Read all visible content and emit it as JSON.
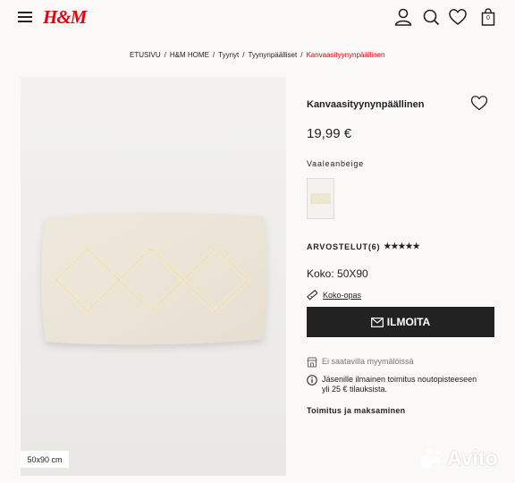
{
  "header": {
    "logo": "H&M",
    "bag_count": "0"
  },
  "breadcrumb": {
    "items": [
      "ETUSIVU",
      "H&M HOME",
      "Tyynyt",
      "Tyynynpäälliset"
    ],
    "current": "Kanvaasityynynpäällinen",
    "separator": "/"
  },
  "product": {
    "title": "Kanvaasityynynpäällinen",
    "price": "19,99 €",
    "color_name": "Vaaleanbeige",
    "size_tag": "50x90 cm",
    "reviews_label": "ARVOSTELUT(6)",
    "rating": 5,
    "size_label": "Koko: 50X90",
    "size_guide_label": "Koko-opas",
    "notify_button": "ILMOITA",
    "store_availability": "Ei saatavilla myymälöissä",
    "members_info": [
      "Jäsenille ilmainen toimitus noutopisteeseen",
      "yli 25 € tilauksista."
    ],
    "delivery_link": "Toimitus ja maksaminen"
  },
  "watermark": "Avito",
  "colors": {
    "brand_red": "#e50010",
    "button_dark": "#222222"
  },
  "icons": [
    "menu-icon",
    "user-icon",
    "search-icon",
    "heart-icon",
    "bag-icon",
    "ruler-icon",
    "mail-icon",
    "store-icon",
    "info-icon"
  ]
}
